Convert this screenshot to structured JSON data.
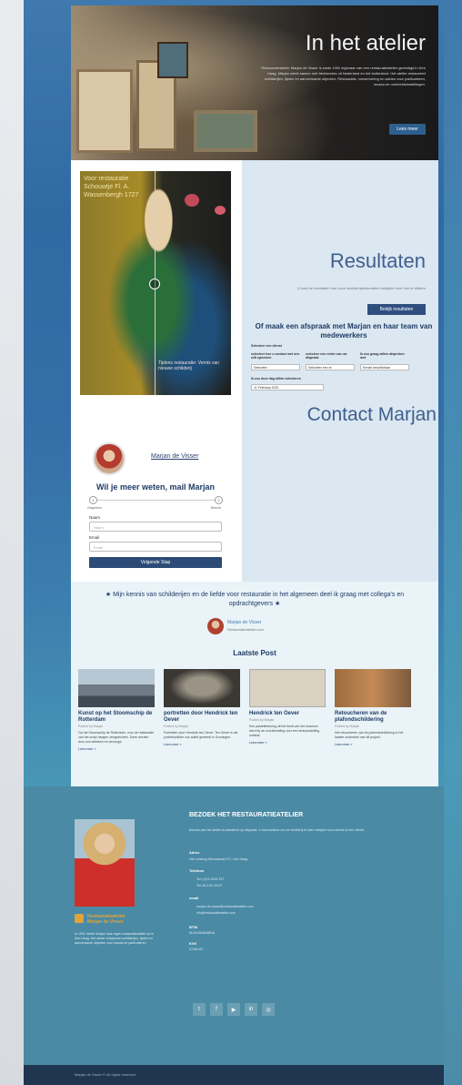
{
  "hero": {
    "title": "In het atelier",
    "text": "Restauratieatelier Marjan de Visser is sinds 1991 eigenaar van een restauratieatelier gevestigd in Den Haag. Marjan werkt samen met freelancers uit Nederland en het buitenland. Het atelier restaureert schilderijen, lijsten en aanverwante objecten. Restauratie, conservering en advies voor particulieren, musea en overheidsinstellingen.",
    "button": "Lees meer"
  },
  "painting": {
    "label_left": "Voor restauratie Schouwtje Fl. A. Wassenbergh 1727",
    "label_right": "Tijdens restauratie: Vernis van nieuwe schilderij"
  },
  "results": {
    "title": "Resultaten",
    "text": "U kunt de resultaten van onze schilderijrestauraties bekijken door hier te klikken",
    "button": "Bekijk resultaten"
  },
  "contact": {
    "title": "Contact Marjan",
    "name_link": "Marjan de Visser",
    "heading": "Wil je meer weten, mail Marjan",
    "step1": "1",
    "step2": "2",
    "step1_label": "Gegevens",
    "step2_label": "Bericht",
    "name_label": "Naam",
    "name_placeholder": "Naam",
    "email_label": "Email",
    "email_placeholder": "Email",
    "next_button": "Volgende Stap"
  },
  "appointment": {
    "title": "Of maak een afspraak met Marjan en haar team van medewerkers",
    "service_label": "Selecteer een dienst",
    "col1_label": "selecteer hoe u contact met ons wilt opnemen",
    "col2_label": "selecteer een reden van uw afspraak",
    "col3_label": "Ik zou graag willen afspreken met",
    "col1_value": "Selecteer",
    "col2_value": "Selecteer een re",
    "col3_value": "Eerste beschikbaar",
    "date_label": "Ik zou deze dag willen selecteren",
    "date_value": "11 February 2022"
  },
  "quote": {
    "text": "★ Mijn kennis van schilderijen en de liefde voor restauratie in het algemeen deel ik graag met collega's en opdrachtgevers ★",
    "name": "Marjan de Visser",
    "site": "Restauratieatelier.com"
  },
  "blog": {
    "title": "Laatste Post",
    "posts": [
      {
        "title": "Kunst op het Stoomschip de Rotterdam",
        "date": "Posted by Marjan",
        "text": "Op het Stoomschip de Rotterdam, voor de restauratie van het schip hangen zeegezichten. Deze worden door ons bekeken en verzorgd.",
        "more": "Lees meer »"
      },
      {
        "title": "portretten door Hendrick ten Oever",
        "date": "Posted by Marjan",
        "text": "Portretten door Hendrick ten Oever. Ten Oever is als portretschilder ook actief geweest in Groningen.",
        "more": "Lees meer »"
      },
      {
        "title": "Hendrick ten Oever",
        "date": "Posted by Marjan",
        "text": "Een pasteltekening uit het bezit van het museum werd bij de voorbereiding voor een tentoonstelling ontdekt.",
        "more": "Lees meer »"
      },
      {
        "title": "Retoucheren van de plafondschildering",
        "date": "Posted by Marjan",
        "text": "Het retoucheren van de plafondschildering in het laatste onderdeel van dit project.",
        "more": "Lees meer »"
      }
    ]
  },
  "footer": {
    "logo_text": "Restauratieatelier",
    "logo_sub": "Marjan de Visser",
    "about": "In 1991 richtte Marjan haar eigen restauratieatelier op in Den Haag. Het atelier restaureert schilderijen, lijsten en aanverwante objecten voor musea en particulieren.",
    "heading": "BEZOEK HET RESTAURATIEATELIER",
    "intro": "Bezoek aan het atelier is uitsluitend op afspraak. U bent welkom om uw schilderij te laten bekijken voor advies of een offerte.",
    "address_label": "Adres",
    "address": "Van Limburg Stirumstraat 217, Den Haag",
    "phone_label": "Telefoon",
    "phone1": "Tel. (0)70 3000 237",
    "phone2": "Tel. 06 2111 95 87",
    "email_label": "email",
    "email1": "marjan.de.visser@restauratieatelier.com",
    "email2": "info@restauratieatelier.com",
    "btw_label": "BTW",
    "btw": "NL001584608B16",
    "kvk_label": "KVK",
    "kvk": "27361447",
    "copyright": "Marjan de Visser © All rights reserved"
  }
}
